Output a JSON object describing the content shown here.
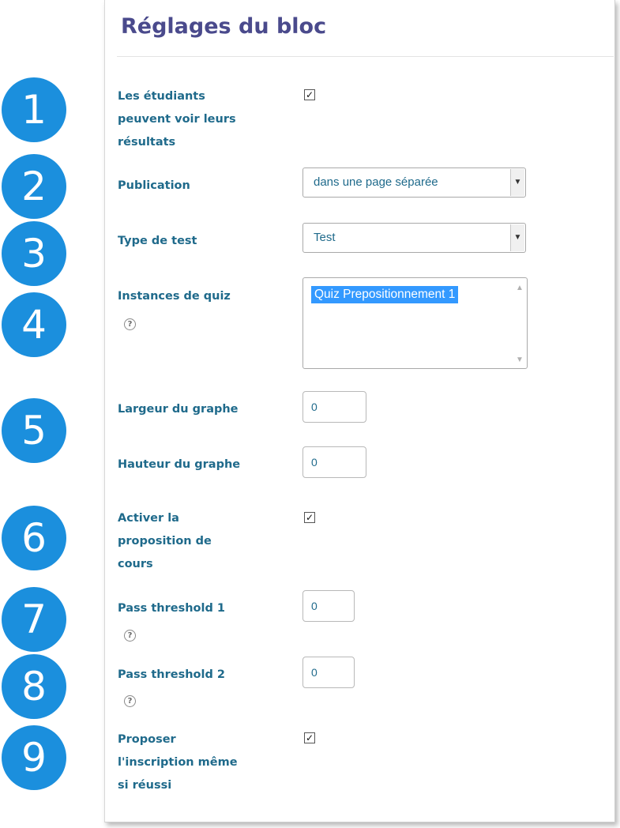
{
  "panel": {
    "title": "Réglages du bloc"
  },
  "markers": [
    "1",
    "2",
    "3",
    "4",
    "5",
    "6",
    "7",
    "8",
    "9"
  ],
  "help_icon": {
    "glyph": "?",
    "name": "help-icon"
  },
  "checkbox_glyph": "✓",
  "colors": {
    "marker": "#1b8fdd",
    "label": "#1f6a8b",
    "title": "#4a4a8c",
    "selected_option": "#3399ff"
  },
  "fields": {
    "students_see_results": {
      "label_lines": [
        "Les étudiants",
        "peuvent voir leurs",
        "résultats"
      ],
      "checked": true
    },
    "publication": {
      "label": "Publication",
      "value": "dans une page séparée"
    },
    "test_type": {
      "label": "Type de test",
      "value": "Test"
    },
    "quiz_instances": {
      "label": "Instances de quiz",
      "options": [
        "Quiz Prepositionnement 1"
      ],
      "selected": "Quiz Prepositionnement 1"
    },
    "graph_width": {
      "label": "Largeur du graphe",
      "value": "0"
    },
    "graph_height": {
      "label": "Hauteur du graphe",
      "value": "0"
    },
    "course_proposal": {
      "label_lines": [
        "Activer la",
        "proposition de",
        "cours"
      ],
      "checked": true
    },
    "pass_threshold_1": {
      "label": "Pass threshold 1",
      "value": "0"
    },
    "pass_threshold_2": {
      "label": "Pass threshold 2",
      "value": "0"
    },
    "propose_enrolment": {
      "label_lines": [
        "Proposer",
        "l'inscription même",
        "si réussi"
      ],
      "checked": true
    }
  }
}
